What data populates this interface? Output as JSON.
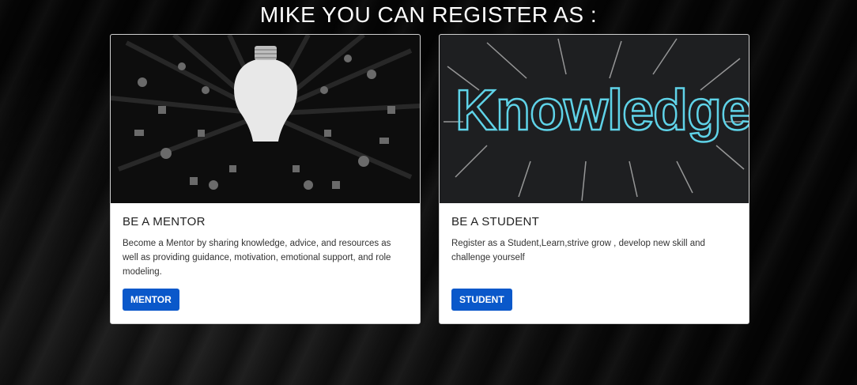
{
  "page": {
    "heading": "MIKE YOU CAN REGISTER AS :"
  },
  "cards": [
    {
      "title": "BE A MENTOR",
      "description": "Become a Mentor by sharing knowledge, advice, and resources as well as providing guidance, motivation, emotional support, and role modeling.",
      "button_label": "MENTOR",
      "image": "lightbulb-icons-illustration"
    },
    {
      "title": "BE A STUDENT",
      "description": "Register as a Student,Learn,strive grow , develop new skill and challenge yourself",
      "button_label": "STUDENT",
      "image": "knowledge-chalkboard-illustration",
      "image_text": "Knowledge"
    }
  ],
  "colors": {
    "button": "#0a58ca",
    "background": "#0b0b0b",
    "chalk": "#5fd3e8"
  }
}
